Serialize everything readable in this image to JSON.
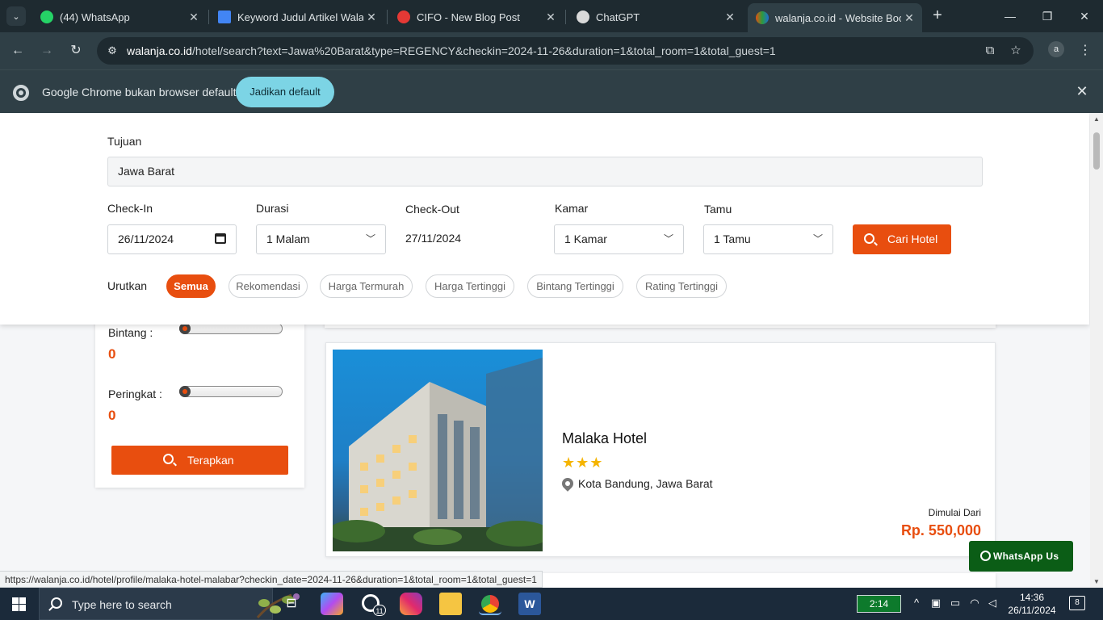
{
  "browser": {
    "tabs": [
      {
        "title": "(44) WhatsApp",
        "favicon_color": "#25d366",
        "active": false
      },
      {
        "title": "Keyword Judul Artikel Walanja",
        "favicon_color": "#4285f4",
        "active": false
      },
      {
        "title": "CIFO - New Blog Post",
        "favicon_color": "#e53935",
        "active": false
      },
      {
        "title": "ChatGPT",
        "favicon_color": "#d9d9d9",
        "active": false
      },
      {
        "title": "walanja.co.id - Website Booking",
        "favicon_color": "#e84e0f",
        "active": true
      }
    ],
    "url_host": "walanja.co.id",
    "url_path": "/hotel/search?text=Jawa%20Barat&type=REGENCY&checkin=2024-11-26&duration=1&total_room=1&total_guest=1",
    "profile_initial": "a",
    "infobar_text": "Google Chrome bukan browser default",
    "infobar_button": "Jadikan default",
    "status_url": "https://walanja.co.id/hotel/profile/malaka-hotel-malabar?checkin_date=2024-11-26&duration=1&total_room=1&total_guest=1"
  },
  "search": {
    "destination_label": "Tujuan",
    "destination_value": "Jawa Barat",
    "checkin_label": "Check-In",
    "checkin_value": "26/11/2024",
    "duration_label": "Durasi",
    "duration_value": "1 Malam",
    "checkout_label": "Check-Out",
    "checkout_value": "27/11/2024",
    "room_label": "Kamar",
    "room_value": "1 Kamar",
    "guest_label": "Tamu",
    "guest_value": "1 Tamu",
    "submit_label": "Cari Hotel",
    "sort_label": "Urutkan",
    "sort_options": [
      "Semua",
      "Rekomendasi",
      "Harga Termurah",
      "Harga Tertinggi",
      "Bintang Tertinggi",
      "Rating Tertinggi"
    ],
    "sort_active": "Semua",
    "accent_color": "#e84e0f"
  },
  "filters": {
    "star_label": "Bintang :",
    "star_value": "0",
    "rating_label": "Peringkat :",
    "rating_value": "0",
    "apply_label": "Terapkan"
  },
  "results": [
    {
      "name": "Malaka Hotel",
      "stars": 3,
      "location": "Kota Bandung, Jawa Barat",
      "price_prefix": "Dimulai Dari",
      "price": "Rp. 550,000"
    }
  ],
  "whatsapp_button": "WhatsApp Us",
  "taskbar": {
    "search_placeholder": "Type here to search",
    "whatsapp_badge": "11",
    "battery_time": "2:14",
    "time": "14:36",
    "date": "26/11/2024",
    "notification_count": "8"
  }
}
